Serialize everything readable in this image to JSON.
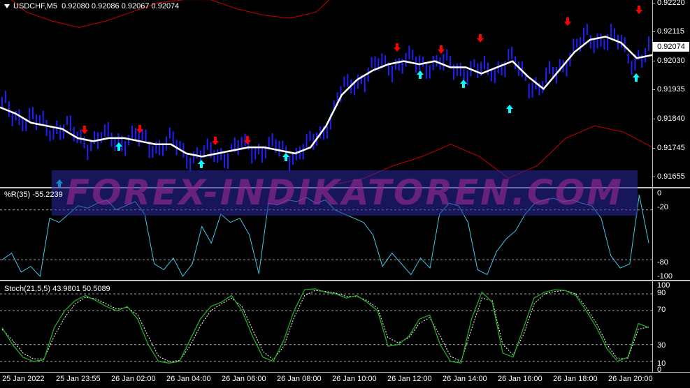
{
  "main_pane": {
    "symbol": "USDCHF,M5",
    "ohlc": "0.92080 0.92086 0.92067 0.92074",
    "current_price": "0.92074"
  },
  "price_axis": [
    "0.92220",
    "0.92115",
    "0.92030",
    "0.91935",
    "0.91840",
    "0.91745",
    "0.91655"
  ],
  "wpr_pane": {
    "title": "%R(35) -55.2239",
    "levels": [
      "0",
      "-20",
      "-80",
      "-100"
    ]
  },
  "stoch_pane": {
    "title": "Stoch(21,5,5) 43.9801 50.5089",
    "levels": [
      "100",
      "90",
      "70",
      "30",
      "10",
      "0"
    ]
  },
  "time_axis": [
    "25 Jan 2022",
    "25 Jan 23:55",
    "26 Jan 02:00",
    "26 Jan 04:00",
    "26 Jan 06:00",
    "26 Jan 08:00",
    "26 Jan 10:00",
    "26 Jan 12:00",
    "26 Jan 14:00",
    "26 Jan 16:00",
    "26 Jan 18:00",
    "26 Jan 20:00"
  ],
  "watermark": "FOREX-INDIKATOREN.COM",
  "colors": {
    "candles": "#2020ff",
    "ma_line": "#ffffff",
    "bands": "#cc0000",
    "sell_arrow": "#ff0000",
    "buy_arrow": "#00ffff",
    "wpr_line": "#40c8e8",
    "stoch_main": "#22aa22",
    "stoch_signal": "#ffffff"
  },
  "chart_data": [
    {
      "type": "line",
      "name": "price",
      "x_range": [
        "25 Jan 2022",
        "26 Jan 20:00"
      ],
      "ylim": [
        0.9162,
        0.9225
      ],
      "series": [
        {
          "name": "ma",
          "values": [
            0.9188,
            0.9186,
            0.9183,
            0.9182,
            0.9181,
            0.9178,
            0.9177,
            0.9178,
            0.9178,
            0.9177,
            0.9176,
            0.9176,
            0.9173,
            0.9172,
            0.9173,
            0.9174,
            0.9175,
            0.9175,
            0.9174,
            0.9173,
            0.9175,
            0.9182,
            0.9192,
            0.9197,
            0.92,
            0.9202,
            0.9203,
            0.9202,
            0.9203,
            0.9201,
            0.9201,
            0.9199,
            0.9201,
            0.9203,
            0.9198,
            0.9194,
            0.92,
            0.9206,
            0.921,
            0.9211,
            0.9209,
            0.9204,
            0.9205
          ]
        },
        {
          "name": "band_upper",
          "values": [
            0.9226,
            0.9219,
            0.9216,
            0.9214,
            0.9216,
            0.9219,
            0.9222,
            0.9223,
            0.9223,
            0.922,
            0.9218,
            0.9217,
            0.9219,
            0.9227
          ]
        },
        {
          "name": "band_lower",
          "values": [
            0.9163,
            0.9165,
            0.9169,
            0.9172,
            0.9176,
            0.9172,
            0.9165,
            0.9169,
            0.9178,
            0.9182,
            0.918,
            0.9175
          ]
        }
      ],
      "sell_arrows": 12,
      "buy_arrows": 10
    },
    {
      "type": "line",
      "name": "%R(35)",
      "ylim": [
        -100,
        0
      ],
      "levels": [
        -20,
        -80
      ],
      "values": [
        -80,
        -72,
        -95,
        -88,
        -100,
        -30,
        -35,
        -25,
        -15,
        -18,
        -12,
        -8,
        -20,
        -15,
        -10,
        -25,
        -85,
        -92,
        -78,
        -100,
        -85,
        -40,
        -60,
        -25,
        -35,
        -30,
        -50,
        -97,
        -12,
        -14,
        -8,
        -10,
        -5,
        -12,
        -8,
        -20,
        -25,
        -30,
        -35,
        -50,
        -88,
        -72,
        -85,
        -98,
        -78,
        -90,
        -25,
        -12,
        -15,
        -35,
        -92,
        -98,
        -70,
        -55,
        -45,
        -25,
        -12,
        -8,
        -6,
        -10,
        -8,
        -12,
        -15,
        -30,
        -75,
        -90,
        -85,
        -2,
        -60
      ]
    },
    {
      "type": "line",
      "name": "Stoch(21,5,5)",
      "ylim": [
        0,
        100
      ],
      "levels": [
        90,
        70,
        30,
        10
      ],
      "series": [
        {
          "name": "main",
          "values": [
            50,
            30,
            15,
            10,
            12,
            50,
            70,
            82,
            88,
            82,
            75,
            70,
            75,
            60,
            30,
            10,
            8,
            10,
            35,
            60,
            75,
            80,
            88,
            70,
            40,
            15,
            10,
            35,
            70,
            95,
            96,
            92,
            90,
            85,
            88,
            80,
            70,
            28,
            30,
            40,
            60,
            65,
            30,
            10,
            8,
            60,
            92,
            80,
            20,
            15,
            50,
            85,
            92,
            95,
            94,
            88,
            70,
            50,
            25,
            10,
            15,
            55,
            50
          ]
        },
        {
          "name": "signal",
          "values": [
            48,
            35,
            20,
            13,
            13,
            40,
            62,
            78,
            86,
            84,
            78,
            72,
            74,
            65,
            40,
            16,
            10,
            11,
            28,
            52,
            70,
            78,
            85,
            75,
            48,
            22,
            12,
            28,
            62,
            88,
            94,
            93,
            91,
            87,
            87,
            82,
            73,
            38,
            32,
            38,
            55,
            62,
            40,
            16,
            10,
            48,
            85,
            82,
            30,
            18,
            42,
            78,
            90,
            93,
            94,
            90,
            74,
            55,
            30,
            13,
            14,
            48,
            51
          ]
        }
      ]
    }
  ]
}
